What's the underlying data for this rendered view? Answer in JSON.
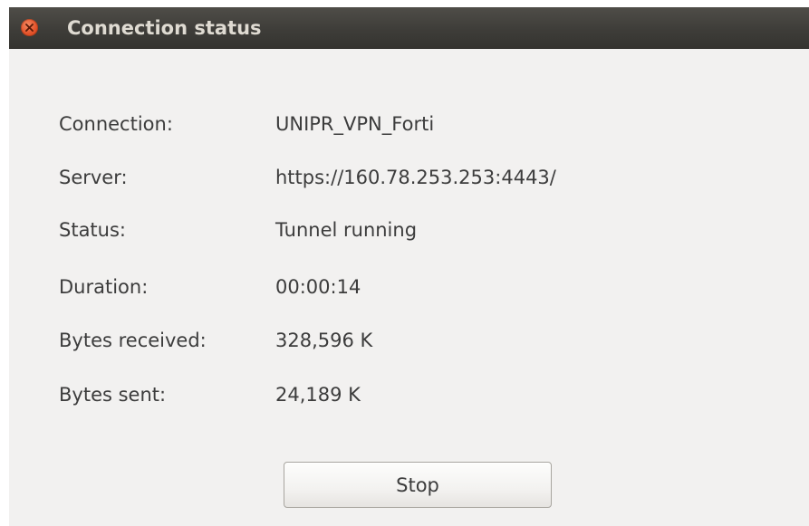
{
  "window": {
    "title": "Connection status"
  },
  "details": [
    {
      "label": "Connection:",
      "value": "UNIPR_VPN_Forti"
    },
    {
      "label": "Server:",
      "value": "https://160.78.253.253:4443/"
    },
    {
      "label": "Status:",
      "value": "Tunnel running"
    },
    {
      "label": "Duration:",
      "value": "00:00:14"
    },
    {
      "label": "Bytes received:",
      "value": "328,596 K"
    },
    {
      "label": "Bytes sent:",
      "value": "24,189 K"
    }
  ],
  "actions": {
    "stop_label": "Stop"
  },
  "icons": {
    "close": "close-icon"
  },
  "colors": {
    "titlebar": "#3e3d39",
    "close_button": "#e4542b",
    "background": "#f2f1f0",
    "text": "#3c3c3c"
  }
}
